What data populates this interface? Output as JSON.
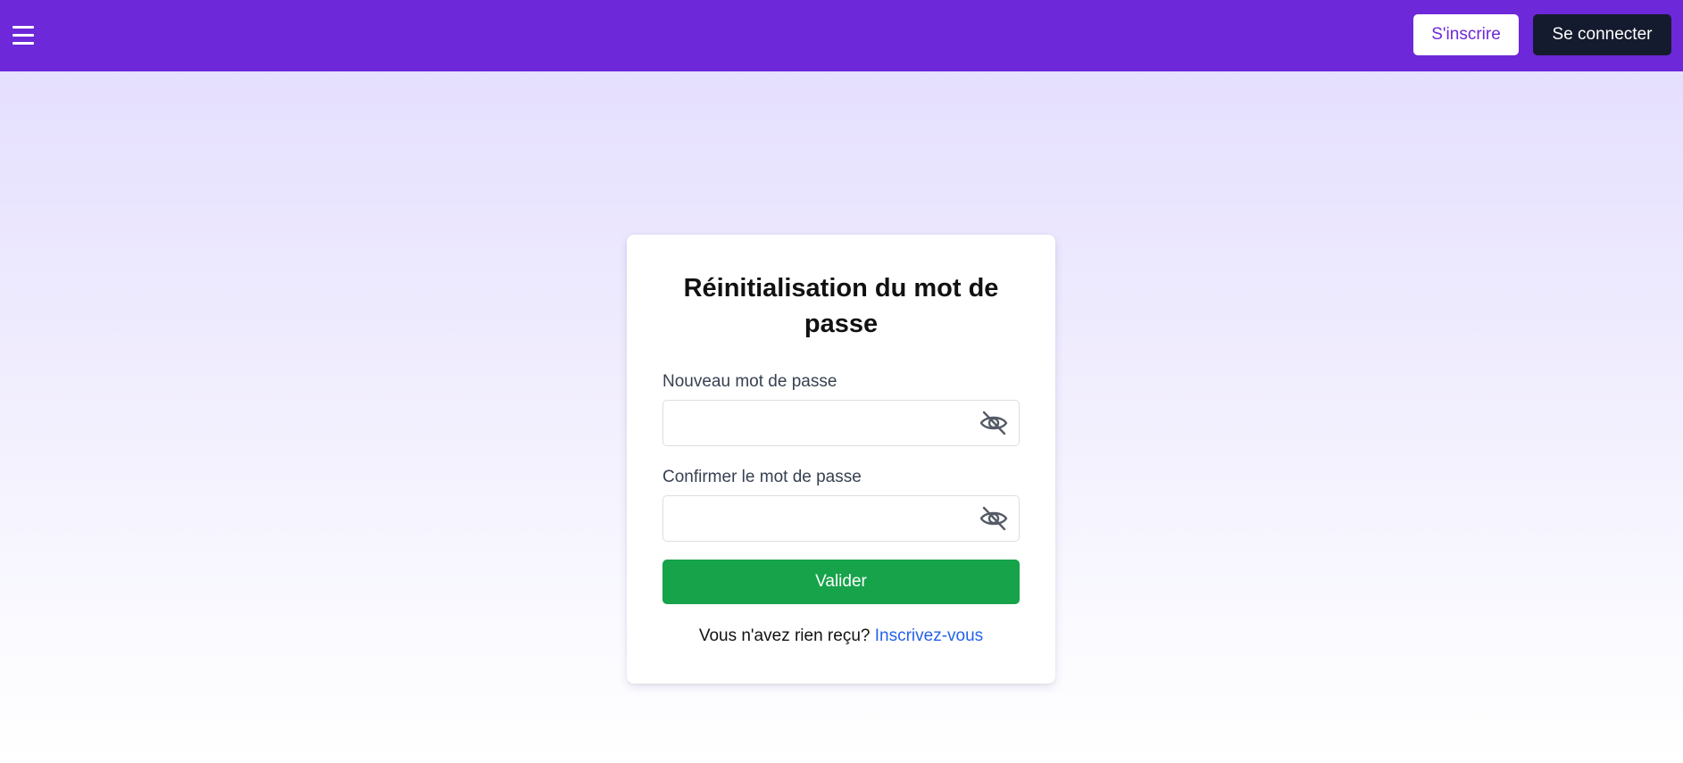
{
  "header": {
    "menu_icon": "hamburger-menu-icon",
    "signup_label": "S'inscrire",
    "login_label": "Se connecter",
    "colors": {
      "bar": "#6d28d9",
      "login_button": "#151b2e"
    }
  },
  "form": {
    "title": "Réinitialisation du mot de passe",
    "new_password": {
      "label": "Nouveau mot de passe",
      "value": "",
      "toggle_icon": "eye-slash-icon"
    },
    "confirm_password": {
      "label": "Confirmer le mot de passe",
      "value": "",
      "toggle_icon": "eye-slash-icon"
    },
    "submit_label": "Valider",
    "submit_color": "#16a34a",
    "footer_text": "Vous n'avez rien reçu?",
    "footer_link": "Inscrivez-vous",
    "link_color": "#2563eb"
  }
}
